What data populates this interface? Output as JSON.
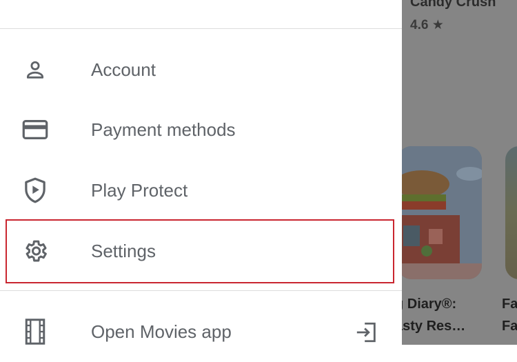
{
  "background": {
    "app_title": "Candy Crush",
    "rating": "4.6 ★",
    "card_caption_line1": "g Diary®:",
    "card_caption_line2": "asty Res…",
    "card2_caption_line1": "Fa",
    "card2_caption_line2": "Fa"
  },
  "drawer": {
    "items": [
      {
        "label": "Account",
        "icon": "account-icon"
      },
      {
        "label": "Payment methods",
        "icon": "credit-card-icon"
      },
      {
        "label": "Play Protect",
        "icon": "play-protect-icon"
      },
      {
        "label": "Settings",
        "icon": "gear-icon"
      },
      {
        "label": "Open Movies app",
        "icon": "film-icon",
        "trailing_icon": "open-external-icon"
      }
    ]
  },
  "colors": {
    "highlight": "#c9252f",
    "label": "#5f6368",
    "scrim": "#858585"
  }
}
